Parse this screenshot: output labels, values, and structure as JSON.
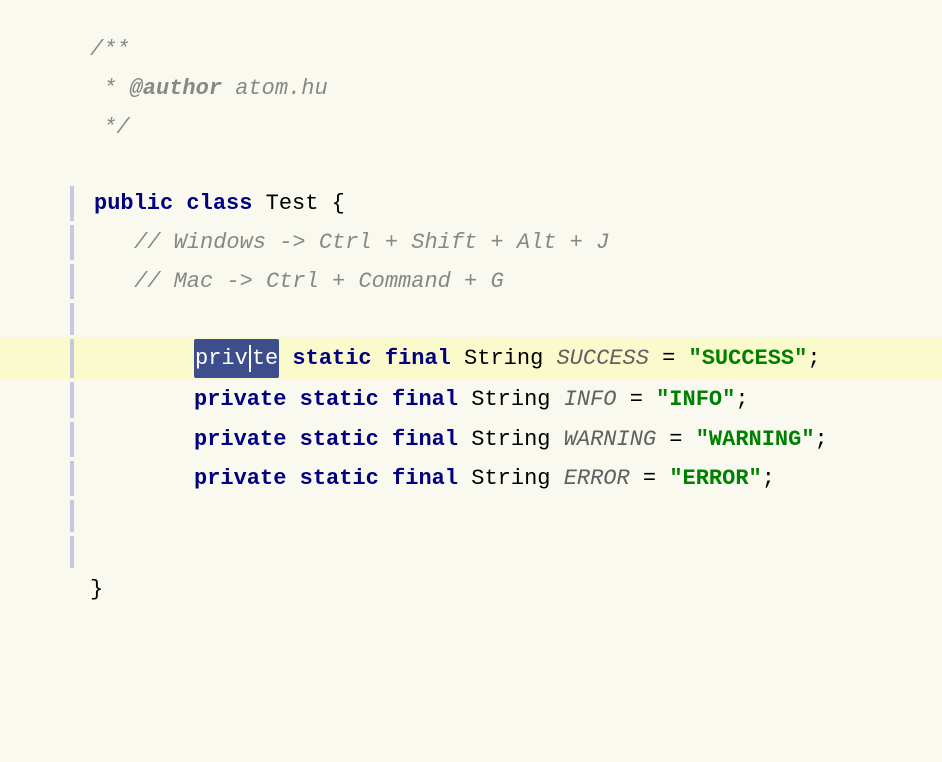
{
  "code": {
    "lines": [
      {
        "id": "l1",
        "type": "javadoc",
        "content": "/**"
      },
      {
        "id": "l2",
        "type": "javadoc",
        "content": " * @author atom.hu"
      },
      {
        "id": "l3",
        "type": "javadoc",
        "content": " */"
      },
      {
        "id": "l4",
        "type": "empty"
      },
      {
        "id": "l5",
        "type": "class-decl",
        "content": "public class Test {"
      },
      {
        "id": "l6",
        "type": "comment-indent",
        "content": "// Windows -> Ctrl + Shift + Alt + J"
      },
      {
        "id": "l7",
        "type": "comment-indent",
        "content": "// Mac -> Ctrl + Command + G"
      },
      {
        "id": "l8",
        "type": "empty"
      },
      {
        "id": "l9",
        "type": "field-highlighted",
        "selected": "private",
        "rest": " static final String SUCCESS = \"SUCCESS\";"
      },
      {
        "id": "l10",
        "type": "field",
        "content": "private static final String INFO = \"INFO\";"
      },
      {
        "id": "l11",
        "type": "field",
        "content": "private static final String WARNING = \"WARNING\";"
      },
      {
        "id": "l12",
        "type": "field",
        "content": "private static final String ERROR = \"ERROR\";"
      },
      {
        "id": "l13",
        "type": "empty"
      },
      {
        "id": "l14",
        "type": "empty"
      },
      {
        "id": "l15",
        "type": "closing-brace",
        "content": "}"
      }
    ]
  }
}
